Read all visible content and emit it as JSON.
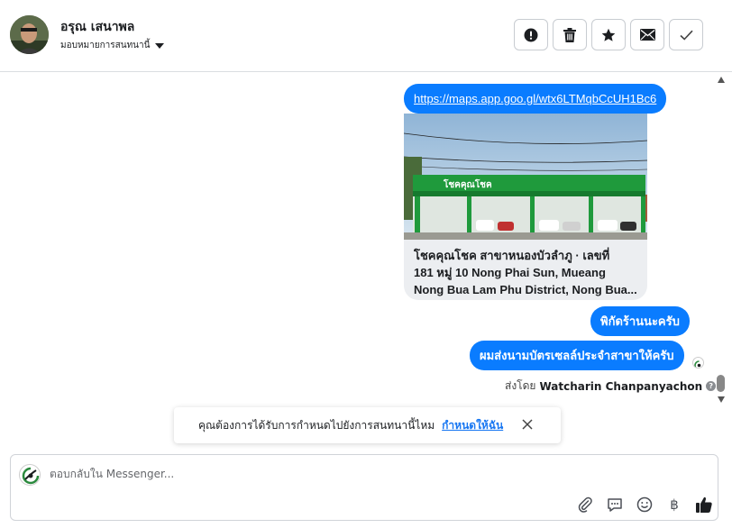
{
  "header": {
    "contact_name": "อรุณ เสนาพล",
    "assign_label": "มอบหมายการสนทนานี้",
    "actions": [
      "report-spam",
      "delete",
      "star",
      "mark-unread",
      "mark-done"
    ]
  },
  "messages": {
    "link_url": "https://maps.app.goo.gl/wtx6LTMqbCcUH1Bc6",
    "card": {
      "image_sign": "โชคคุณโชค",
      "line1": "โชคคุณโชค สาขาหนองบัวลำภู · เลขที่",
      "line2": "181 หมู่ 10 Nong Phai Sun, Mueang",
      "line3": "Nong Bua Lam Phu District, Nong Bua..."
    },
    "bubble1": "พิกัดร้านนะครับ",
    "bubble2": "ผมส่งนามบัตรเซลล์ประจำสาขาให้ครับ",
    "sent_by_prefix": "ส่งโดย",
    "sent_by_name": "Watcharin Chanpanyachon"
  },
  "toast": {
    "text": "คุณต้องการได้รับการกำหนดไปยังการสนทนานี้ไหม",
    "cta": "กำหนดให้ฉัน"
  },
  "composer": {
    "placeholder": "ตอบกลับใน Messenger..."
  },
  "colors": {
    "bubble": "#0a7cff",
    "brand_green": "#27a844",
    "link_blue": "#1877f2"
  }
}
